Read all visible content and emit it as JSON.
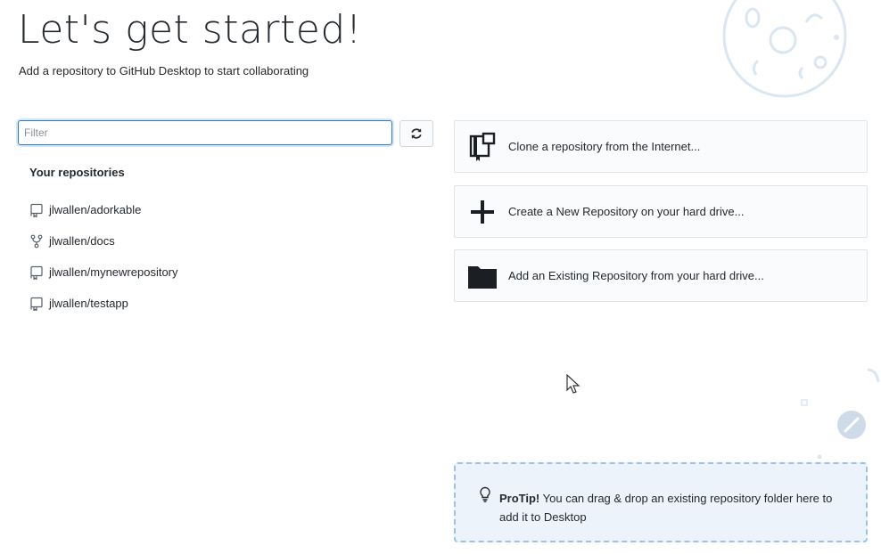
{
  "header": {
    "title": "Let's get started!",
    "subtitle": "Add a repository to GitHub Desktop to start collaborating"
  },
  "filter": {
    "placeholder": "Filter",
    "value": ""
  },
  "repositories": {
    "heading": "Your repositories",
    "items": [
      {
        "name": "jlwallen/adorkable",
        "icon": "repo-icon"
      },
      {
        "name": "jlwallen/docs",
        "icon": "fork-icon"
      },
      {
        "name": "jlwallen/mynewrepository",
        "icon": "repo-icon"
      },
      {
        "name": "jlwallen/testapp",
        "icon": "repo-icon"
      }
    ]
  },
  "actions": {
    "clone": {
      "label": "Clone a repository from the Internet...",
      "icon": "clone-book-icon"
    },
    "create": {
      "label": "Create a New Repository on your hard drive...",
      "icon": "plus-icon"
    },
    "add": {
      "label": "Add an Existing Repository from your hard drive...",
      "icon": "folder-icon"
    }
  },
  "protip": {
    "label": "ProTip!",
    "text": " You can drag & drop an existing repository folder here to add it to Desktop"
  },
  "colors": {
    "accent": "#2b7bd3",
    "decoration": "#dbe6f3",
    "protip_bg": "#edf3fb",
    "protip_border": "#9dc1ec"
  }
}
